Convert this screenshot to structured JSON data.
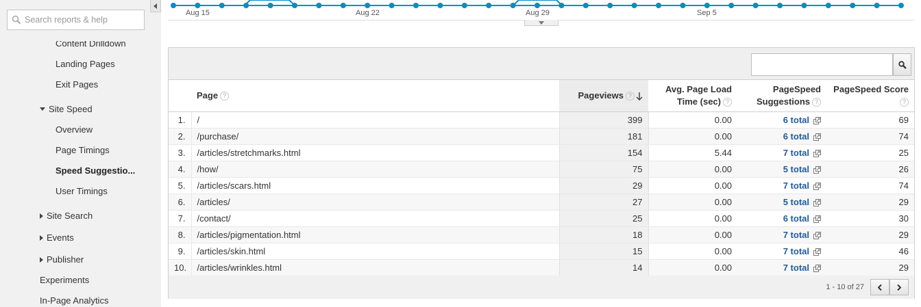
{
  "sidebar": {
    "search_placeholder": "Search reports & help",
    "items": [
      {
        "label": "Content Drilldown",
        "indent": 2
      },
      {
        "label": "Landing Pages",
        "indent": 2
      },
      {
        "label": "Exit Pages",
        "indent": 2
      },
      {
        "label": "Site Speed",
        "indent": 1,
        "expand": "down"
      },
      {
        "label": "Overview",
        "indent": 2
      },
      {
        "label": "Page Timings",
        "indent": 2
      },
      {
        "label": "Speed Suggestio...",
        "indent": 2,
        "active": true
      },
      {
        "label": "User Timings",
        "indent": 2
      },
      {
        "label": "Site Search",
        "indent": 1,
        "expand": "right"
      },
      {
        "label": "Events",
        "indent": 1,
        "expand": "right"
      },
      {
        "label": "Publisher",
        "indent": 1,
        "expand": "right"
      },
      {
        "label": "Experiments",
        "indent": 0
      },
      {
        "label": "In-Page Analytics",
        "indent": 0
      }
    ]
  },
  "timeline": {
    "labels": [
      "Aug 15",
      "Aug 22",
      "Aug 29",
      "Sep 5"
    ],
    "line_color": "#058dc7"
  },
  "table": {
    "columns": {
      "page": "Page",
      "pageviews": "Pageviews",
      "load_time_line1": "Avg. Page Load",
      "load_time_line2": "Time (sec)",
      "sugg_line1": "PageSpeed",
      "sugg_line2": "Suggestions",
      "score": "PageSpeed Score"
    },
    "rows": [
      {
        "idx": "1.",
        "page": "/",
        "pageviews": "399",
        "load": "0.00",
        "sugg": "6 total",
        "score": "69"
      },
      {
        "idx": "2.",
        "page": "/purchase/",
        "pageviews": "181",
        "load": "0.00",
        "sugg": "6 total",
        "score": "74"
      },
      {
        "idx": "3.",
        "page": "/articles/stretchmarks.html",
        "pageviews": "154",
        "load": "5.44",
        "sugg": "7 total",
        "score": "25"
      },
      {
        "idx": "4.",
        "page": "/how/",
        "pageviews": "75",
        "load": "0.00",
        "sugg": "5 total",
        "score": "26"
      },
      {
        "idx": "5.",
        "page": "/articles/scars.html",
        "pageviews": "29",
        "load": "0.00",
        "sugg": "7 total",
        "score": "74"
      },
      {
        "idx": "6.",
        "page": "/articles/",
        "pageviews": "27",
        "load": "0.00",
        "sugg": "5 total",
        "score": "29"
      },
      {
        "idx": "7.",
        "page": "/contact/",
        "pageviews": "25",
        "load": "0.00",
        "sugg": "6 total",
        "score": "30"
      },
      {
        "idx": "8.",
        "page": "/articles/pigmentation.html",
        "pageviews": "18",
        "load": "0.00",
        "sugg": "7 total",
        "score": "29"
      },
      {
        "idx": "9.",
        "page": "/articles/skin.html",
        "pageviews": "15",
        "load": "0.00",
        "sugg": "7 total",
        "score": "46"
      },
      {
        "idx": "10.",
        "page": "/articles/wrinkles.html",
        "pageviews": "14",
        "load": "0.00",
        "sugg": "7 total",
        "score": "29"
      }
    ],
    "range_text": "1 - 10 of 27",
    "help_glyph": "?"
  }
}
